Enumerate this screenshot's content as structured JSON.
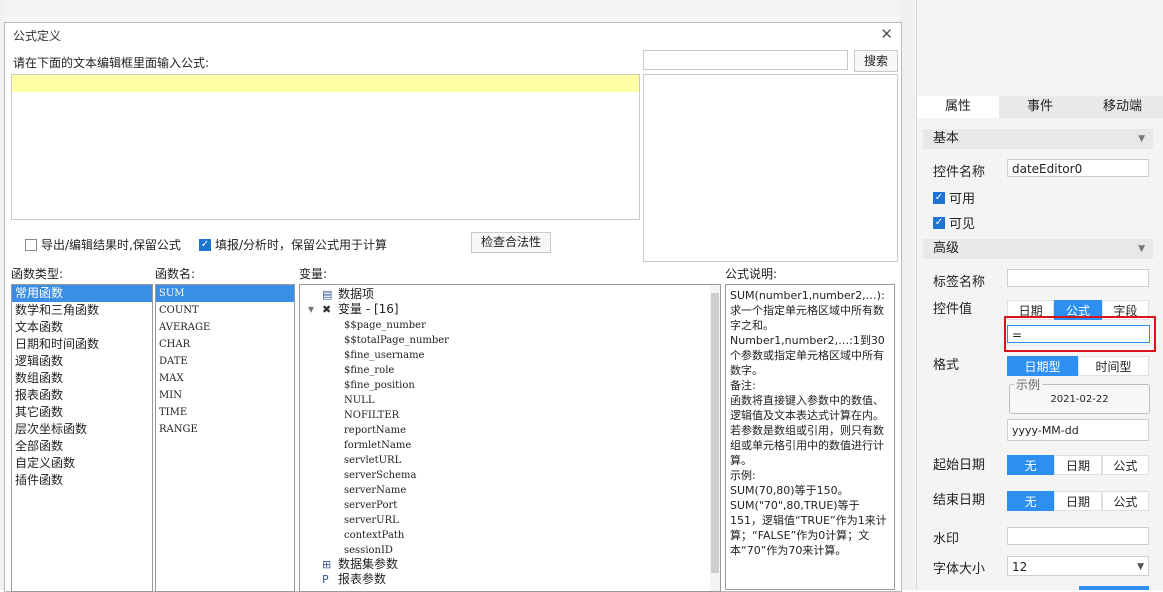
{
  "dialog": {
    "title": "公式定义",
    "close_glyph": "✕",
    "instruction": "请在下面的文本编辑框里面输入公式:",
    "search_button": "搜索",
    "option_export": "导出/编辑结果时,保留公式",
    "option_fill": "填报/分析时，保留公式用于计算",
    "check_button": "检查合法性",
    "label_function_types": "函数类型:",
    "label_function_names": "函数名:",
    "label_variables": "变量:",
    "label_description": "公式说明:",
    "function_types": [
      "常用函数",
      "数学和三角函数",
      "文本函数",
      "日期和时间函数",
      "逻辑函数",
      "数组函数",
      "报表函数",
      "其它函数",
      "层次坐标函数",
      "全部函数",
      "自定义函数",
      "插件函数"
    ],
    "function_names": [
      "SUM",
      "COUNT",
      "AVERAGE",
      "CHAR",
      "DATE",
      "MAX",
      "MIN",
      "TIME",
      "RANGE"
    ],
    "var_data_item": "数据项",
    "var_group": "变量 - [16]",
    "variables": [
      "$$page_number",
      "$$totalPage_number",
      "$fine_username",
      "$fine_role",
      "$fine_position",
      "NULL",
      "NOFILTER",
      "reportName",
      "formletName",
      "servletURL",
      "serverSchema",
      "serverName",
      "serverPort",
      "serverURL",
      "contextPath",
      "sessionID"
    ],
    "var_dataset_params": "数据集参数",
    "var_report_params": "报表参数",
    "description": [
      "SUM(number1,number2,…):求一个指定单元格区域中所有数字之和。",
      "Number1,number2,…:1到30个参数或指定单元格区域中所有数字。",
      "备注:",
      "函数将直接键入参数中的数值、逻辑值及文本表达式计算在内。若参数是数组或引用，则只有数组或单元格引用中的数值进行计算。",
      "示例:",
      "SUM(70,80)等于150。",
      "SUM(\"70\",80,TRUE)等于151，逻辑值“TRUE”作为1来计算；“FALSE”作为0计算；文本“70”作为70来计算。"
    ]
  },
  "panel": {
    "tabs": [
      "属性",
      "事件",
      "移动端"
    ],
    "section_basic": "基本",
    "label_widget_name": "控件名称",
    "widget_name_value": "dateEditor0",
    "label_enabled": "可用",
    "label_visible": "可见",
    "section_advanced": "高级",
    "label_tag_name": "标签名称",
    "label_widget_value": "控件值",
    "value_modes": [
      "日期",
      "公式",
      "字段"
    ],
    "formula_value": "=",
    "label_format": "格式",
    "format_modes": [
      "日期型",
      "时间型"
    ],
    "example_label": "示例",
    "example_value": "2021-02-22",
    "format_pattern": "yyyy-MM-dd",
    "label_start_date": "起始日期",
    "label_end_date": "结束日期",
    "date_modes": [
      "无",
      "日期",
      "公式"
    ],
    "label_watermark": "水印",
    "label_font_size": "字体大小",
    "font_size_value": "12"
  },
  "colors": {
    "accent": "#2d8ff0",
    "highlight_line": "#ffffa8",
    "annotation": "#d6141d",
    "selection": "#3a8ee6"
  }
}
